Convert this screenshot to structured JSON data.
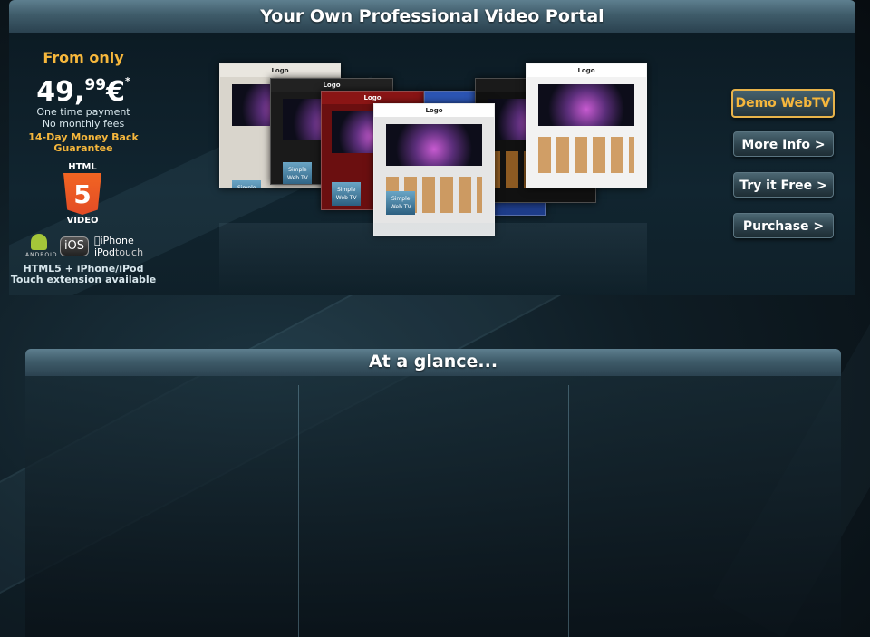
{
  "header": {
    "title": "Your Own Professional Video Portal"
  },
  "pricing": {
    "from_label": "From only",
    "price_main": "49,",
    "price_cents": "99",
    "currency": "€",
    "asterisk": "*",
    "payment_line1": "One time payment",
    "payment_line2": "No monthly fees",
    "guarantee_line1": "14-Day Money Back",
    "guarantee_line2": "Guarantee"
  },
  "html5_badge": {
    "top_label": "HTML",
    "number": "5",
    "bottom_label": "VIDEO"
  },
  "platforms": {
    "android_text": "ANDROID",
    "ios_text": "iOS",
    "iphone_text": "iPhone",
    "ipod_text": "iPod",
    "touch_text": "touch",
    "extension_line1": "HTML5 + iPhone/iPod",
    "extension_line2": "Touch extension available"
  },
  "screenshots": {
    "logo_text": "Logo",
    "badge_line1": "Simple",
    "badge_line2": "Web TV"
  },
  "buttons": {
    "demo": "Demo WebTV",
    "more_info": "More Info >",
    "try_free": "Try it Free >",
    "purchase": "Purchase >"
  },
  "glance": {
    "title": "At a glance..."
  },
  "colors": {
    "accent_orange": "#f6b73c",
    "header_blue": "#3f5c6a",
    "background": "#0f1d25"
  }
}
